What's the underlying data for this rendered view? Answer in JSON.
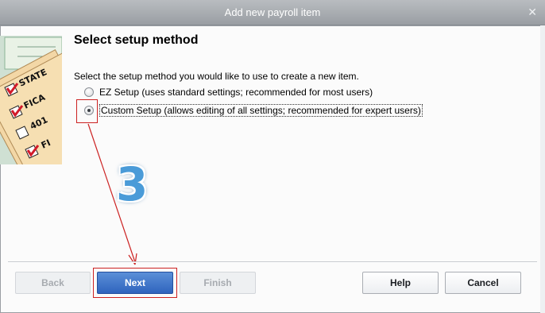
{
  "window": {
    "title": "Add new payroll item",
    "close_icon": "close-icon"
  },
  "panel": {
    "heading": "Select setup method",
    "instruction": "Select the setup method you would like to use to create a new item.",
    "options": [
      {
        "label": "EZ Setup (uses standard settings; recommended for most users)",
        "selected": false
      },
      {
        "label": "Custom Setup (allows editing of all settings; recommended for expert users)",
        "selected": true
      }
    ],
    "side_image_labels": [
      "STATE",
      "FICA",
      "401",
      "FI"
    ]
  },
  "annotation": {
    "step_number": "3",
    "color": "#cc2222"
  },
  "buttons": {
    "back": "Back",
    "next": "Next",
    "finish": "Finish",
    "help": "Help",
    "cancel": "Cancel"
  }
}
